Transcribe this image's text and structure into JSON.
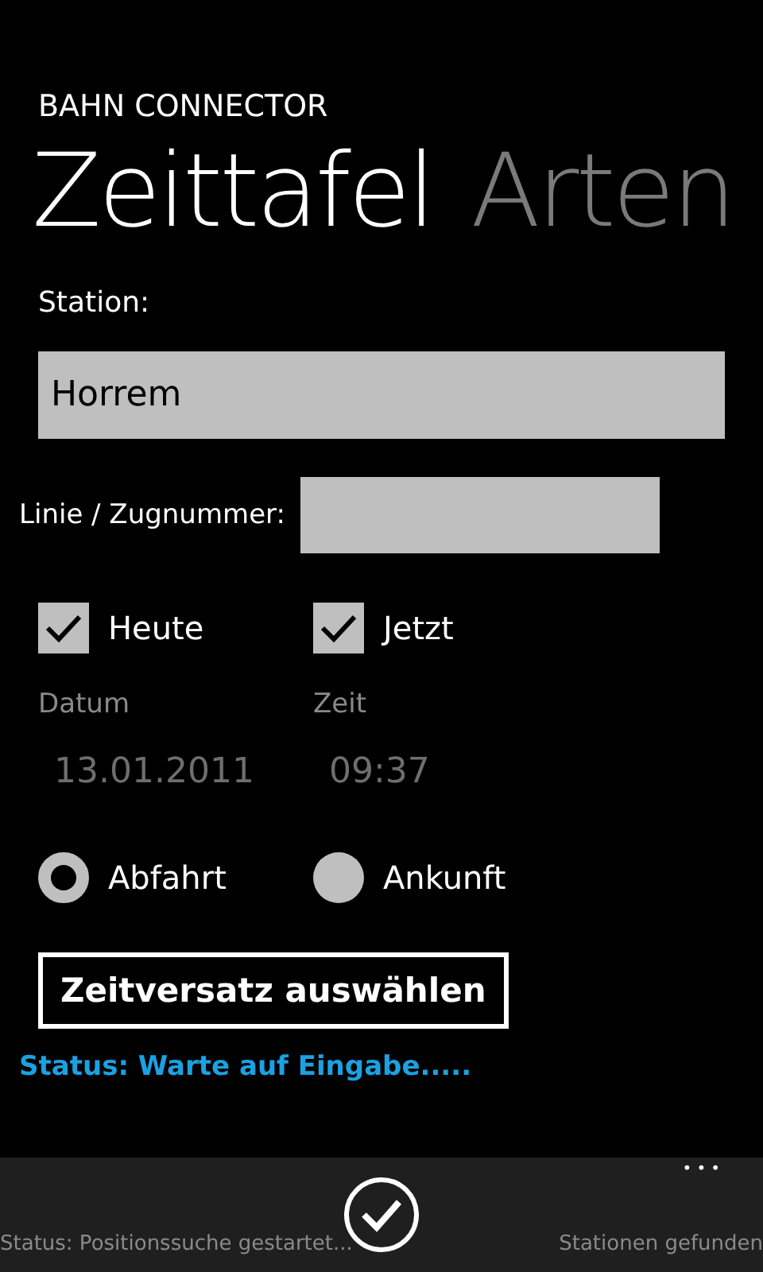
{
  "app_title": "BAHN CONNECTOR",
  "pivot": [
    {
      "label": "Zeittafel",
      "selected": true
    },
    {
      "label": "Arten",
      "selected": false
    }
  ],
  "station": {
    "label": "Station:",
    "value": "Horrem"
  },
  "line": {
    "label": "Linie / Zugnummer:"
  },
  "checks": [
    {
      "label": "Heute",
      "checked": true
    },
    {
      "label": "Jetzt",
      "checked": true
    }
  ],
  "date": {
    "label": "Datum",
    "value": "13.01.2011",
    "disabled": true
  },
  "time": {
    "label": "Zeit",
    "value": "09:37",
    "disabled": true
  },
  "radios": [
    {
      "label": "Abfahrt",
      "selected": true
    },
    {
      "label": "Ankunft",
      "selected": false
    }
  ],
  "offset_button": "Zeitversatz auswählen",
  "status": "Status: Warte auf Eingabe.....",
  "app_bar": {
    "left_text": "Status: Positionssuche gestartet...",
    "right_text": "Stationen gefunden",
    "more": "•••"
  }
}
